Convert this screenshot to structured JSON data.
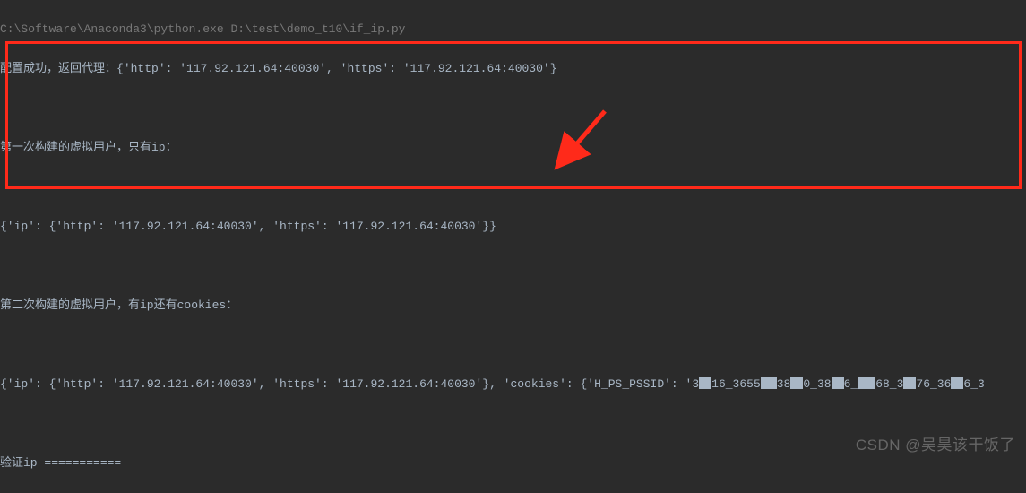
{
  "console": {
    "line1": "C:\\Software\\Anaconda3\\python.exe D:\\test\\demo_t10\\if_ip.py",
    "line2_prefix": "配置成功，返回代理：",
    "line2_dict": "{'http': '117.92.121.64:40030', 'https': '117.92.121.64:40030'}",
    "line3": "第一次构建的虚拟用户，只有ip：",
    "line4": "{'ip': {'http': '117.92.121.64:40030', 'https': '117.92.121.64:40030'}}",
    "line5": "第二次构建的虚拟用户，有ip还有cookies：",
    "line6_a": "{'ip': {'http': '117.92.121.64:40030', 'https': '117.92.121.64:40030'}, 'cookies': {'H_PS_PSSID': '3",
    "line6_b": "16_3655",
    "line6_c": "38",
    "line6_d": "0_38",
    "line6_e": "6_",
    "line6_f": "68_3",
    "line6_g": "76_36",
    "line6_h": "6_3",
    "line7": "验证ip ==========="
  },
  "watermark": "CSDN @吴昊该干饭了"
}
